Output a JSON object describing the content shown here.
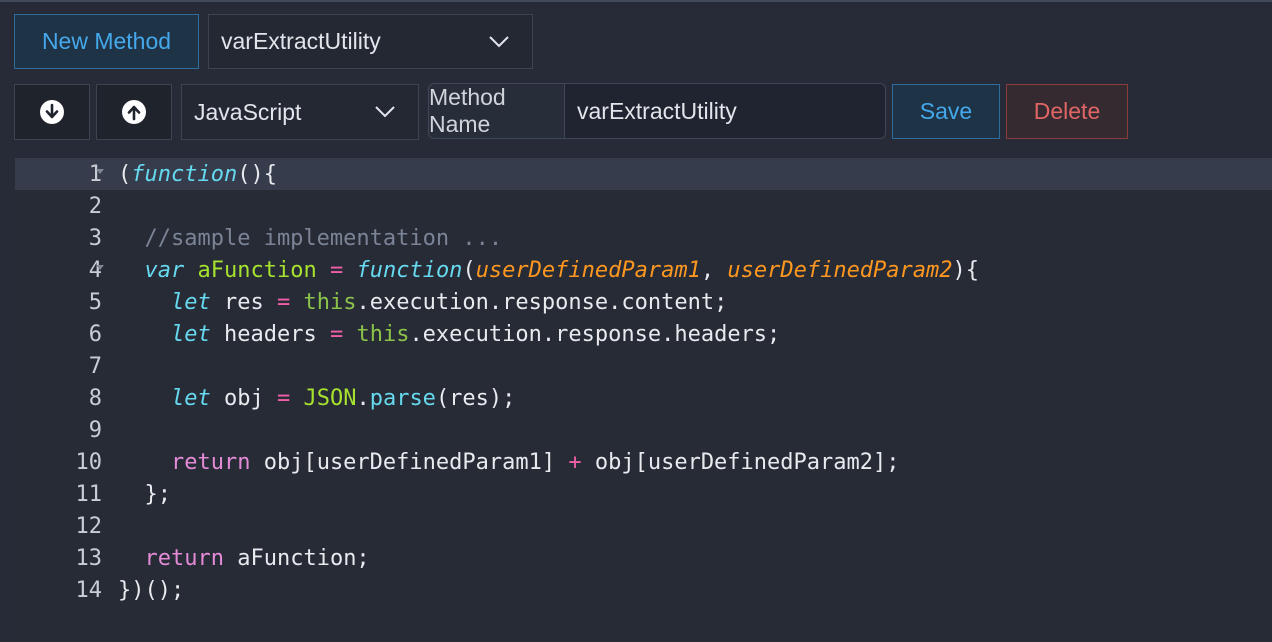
{
  "toolbar": {
    "new_method_label": "New Method",
    "method_select_value": "varExtractUtility",
    "language_select_value": "JavaScript",
    "method_name_label": "Method Name",
    "method_name_value": "varExtractUtility",
    "save_label": "Save",
    "delete_label": "Delete",
    "down_icon": "arrow-down-circle-icon",
    "up_icon": "arrow-up-circle-icon"
  },
  "colors": {
    "background": "#262b37",
    "accent_blue": "#45a8ea",
    "danger_red": "#e06565",
    "active_line": "#363c4b"
  },
  "editor": {
    "line_numbers": [
      "1",
      "2",
      "3",
      "4",
      "5",
      "6",
      "7",
      "8",
      "9",
      "10",
      "11",
      "12",
      "13",
      "14"
    ],
    "lines": [
      [
        "(",
        "function",
        "(){"
      ],
      [],
      [
        "  //sample implementation ..."
      ],
      [
        "  ",
        "var",
        " ",
        "aFunction",
        " ",
        "=",
        " ",
        "function",
        "(",
        "userDefinedParam1",
        ", ",
        "userDefinedParam2",
        "){"
      ],
      [
        "    ",
        "let",
        " res ",
        "=",
        " ",
        "this",
        ".execution.response.content;"
      ],
      [
        "    ",
        "let",
        " headers ",
        "=",
        " ",
        "this",
        ".execution.response.headers;"
      ],
      [],
      [
        "    ",
        "let",
        " obj ",
        "=",
        " ",
        "JSON",
        ".",
        "parse",
        "(res);"
      ],
      [],
      [
        "    ",
        "return",
        " obj[userDefinedParam1] ",
        "+",
        " obj[userDefinedParam2];"
      ],
      [
        "  };"
      ],
      [],
      [
        "  ",
        "return",
        " aFunction;"
      ],
      [
        "})();"
      ]
    ]
  }
}
